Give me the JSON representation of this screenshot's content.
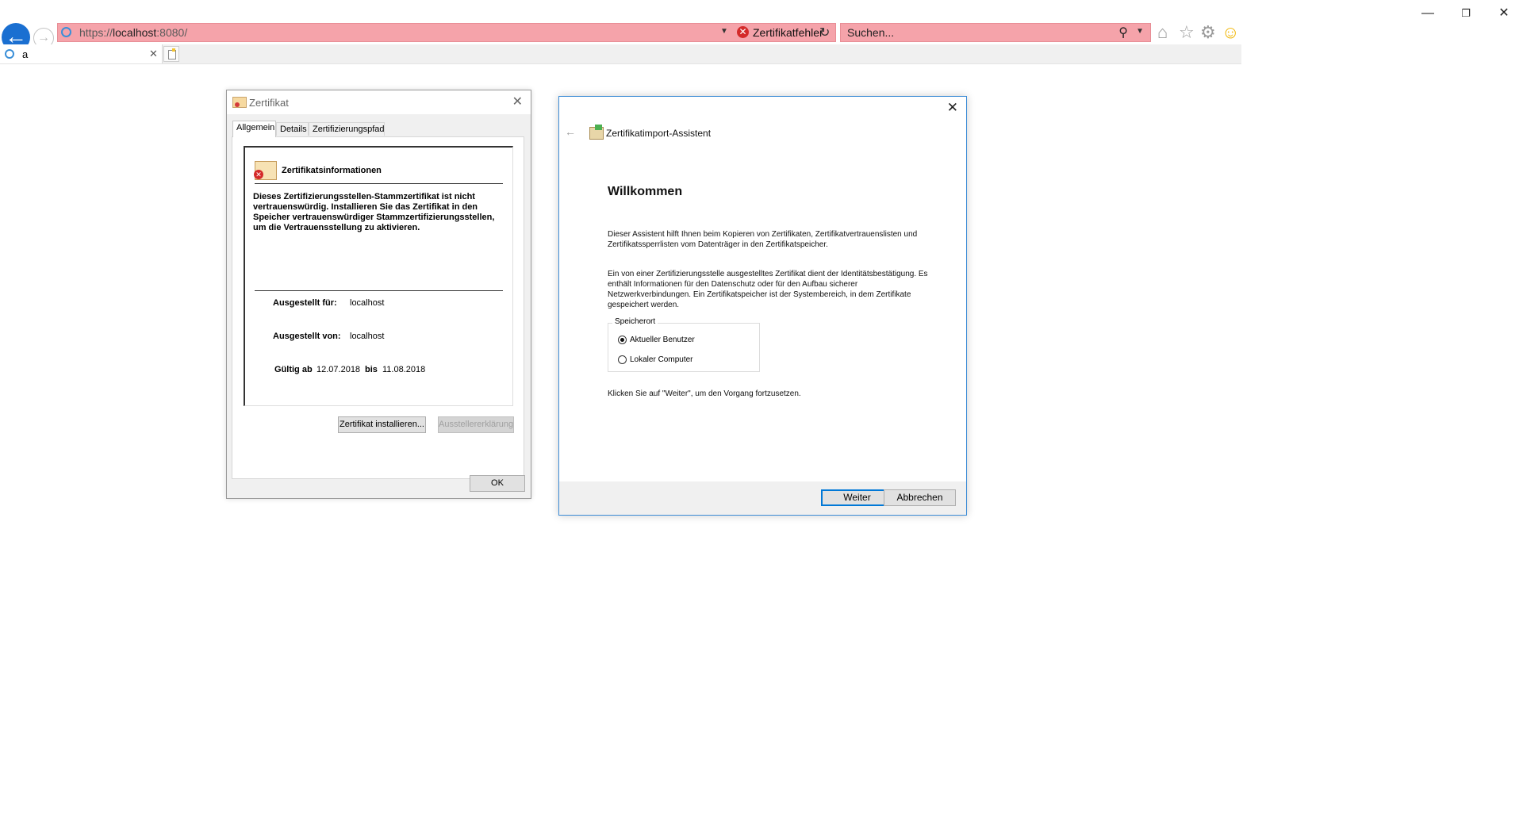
{
  "browser": {
    "address_prefix": "https://",
    "address_host": "localhost",
    "address_suffix": ":8080/",
    "cert_error": "Zertifikatfehler",
    "search_placeholder": "Suchen...",
    "tab_title": "a"
  },
  "cert_dialog": {
    "title": "Zertifikat",
    "tabs": [
      "Allgemein",
      "Details",
      "Zertifizierungspfad"
    ],
    "info_heading": "Zertifikatsinformationen",
    "warning": "Dieses Zertifizierungsstellen-Stammzertifikat ist nicht vertrauenswürdig. Installieren Sie das Zertifikat in den Speicher vertrauenswürdiger Stammzertifizierungsstellen, um die Vertrauensstellung zu aktivieren.",
    "issued_to_label": "Ausgestellt für:",
    "issued_to": "localhost",
    "issued_by_label": "Ausgestellt von:",
    "issued_by": "localhost",
    "valid_from_label": "Gültig ab",
    "valid_from": "12.07.2018",
    "valid_to_label": "bis",
    "valid_to": "11.08.2018",
    "install_button": "Zertifikat installieren...",
    "issuer_statement_button": "Ausstellererklärung",
    "ok_button": "OK"
  },
  "wizard": {
    "title": "Zertifikatimport-Assistent",
    "heading": "Willkommen",
    "para1": "Dieser Assistent hilft Ihnen beim Kopieren von Zertifikaten, Zertifikatvertrauenslisten und Zertifikatssperrlisten vom Datenträger in den Zertifikatspeicher.",
    "para2": "Ein von einer Zertifizierungsstelle ausgestelltes Zertifikat dient der Identitätsbestätigung. Es enthält Informationen für den Datenschutz oder für den Aufbau sicherer Netzwerkverbindungen. Ein Zertifikatspeicher ist der Systembereich, in dem Zertifikate gespeichert werden.",
    "store_legend": "Speicherort",
    "store_options": [
      "Aktueller Benutzer",
      "Lokaler Computer"
    ],
    "store_selected": "Aktueller Benutzer",
    "continue_hint": "Klicken Sie auf \"Weiter\", um den Vorgang fortzusetzen.",
    "next_button": "Weiter",
    "cancel_button": "Abbrechen"
  },
  "colors": {
    "address_error_bg": "#f5a3aa",
    "back_button": "#1a6fd1",
    "wizard_border": "#3c8cd6"
  }
}
